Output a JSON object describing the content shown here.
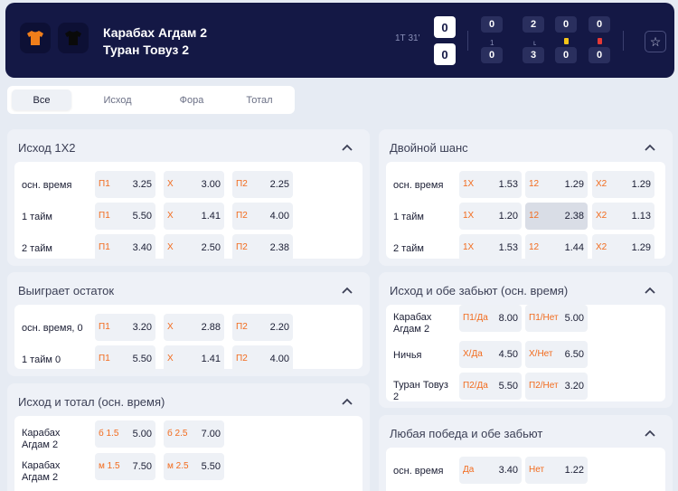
{
  "header": {
    "team1": "Карабах Агдам 2",
    "team2": "Туран Товуз 2",
    "period": "1Т 31'",
    "score1": "0",
    "score2": "0",
    "stats_top": [
      "0",
      "2",
      "0",
      "0"
    ],
    "stats_mid": [
      "1",
      "ʟ"
    ],
    "stats_bottom": [
      "0",
      "3",
      "0",
      "0"
    ],
    "yellow_card_color": "#f5c518",
    "red_card_color": "#e53935",
    "team1_shirt_color": "#f07e1a",
    "team2_shirt_color": "#0a0a0a"
  },
  "tabs": [
    "Все",
    "Исход",
    "Фора",
    "Тотал"
  ],
  "accent_color": "#f26b1d",
  "markets": {
    "m1": {
      "title": "Исход 1X2",
      "rows": [
        {
          "label": "осн. время",
          "odds": [
            {
              "n": "П1",
              "v": "3.25"
            },
            {
              "n": "X",
              "v": "3.00"
            },
            {
              "n": "П2",
              "v": "2.25"
            }
          ]
        },
        {
          "label": "1 тайм",
          "odds": [
            {
              "n": "П1",
              "v": "5.50"
            },
            {
              "n": "X",
              "v": "1.41"
            },
            {
              "n": "П2",
              "v": "4.00"
            }
          ]
        },
        {
          "label": "2 тайм",
          "odds": [
            {
              "n": "П1",
              "v": "3.40"
            },
            {
              "n": "X",
              "v": "2.50"
            },
            {
              "n": "П2",
              "v": "2.38"
            }
          ]
        }
      ]
    },
    "m2": {
      "title": "Выиграет остаток",
      "rows": [
        {
          "label": "осн. время, 0",
          "odds": [
            {
              "n": "П1",
              "v": "3.20"
            },
            {
              "n": "X",
              "v": "2.88"
            },
            {
              "n": "П2",
              "v": "2.20"
            }
          ]
        },
        {
          "label": "1 тайм 0",
          "odds": [
            {
              "n": "П1",
              "v": "5.50"
            },
            {
              "n": "X",
              "v": "1.41"
            },
            {
              "n": "П2",
              "v": "4.00"
            }
          ]
        }
      ]
    },
    "m3": {
      "title": "Исход и тотал (осн. время)",
      "rows": [
        {
          "label": "Карабах Агдам 2",
          "odds": [
            {
              "n": "б 1.5",
              "v": "5.00"
            },
            {
              "n": "б 2.5",
              "v": "7.00"
            }
          ]
        },
        {
          "label": "Карабах Агдам 2",
          "odds": [
            {
              "n": "м 1.5",
              "v": "7.50"
            },
            {
              "n": "м 2.5",
              "v": "5.50"
            }
          ]
        }
      ]
    },
    "m4": {
      "title": "Двойной шанс",
      "rows": [
        {
          "label": "осн. время",
          "odds": [
            {
              "n": "1X",
              "v": "1.53"
            },
            {
              "n": "12",
              "v": "1.29"
            },
            {
              "n": "X2",
              "v": "1.29"
            }
          ]
        },
        {
          "label": "1 тайм",
          "odds": [
            {
              "n": "1X",
              "v": "1.20"
            },
            {
              "n": "12",
              "v": "2.38"
            },
            {
              "n": "X2",
              "v": "1.13"
            }
          ]
        },
        {
          "label": "2 тайм",
          "odds": [
            {
              "n": "1X",
              "v": "1.53"
            },
            {
              "n": "12",
              "v": "1.44"
            },
            {
              "n": "X2",
              "v": "1.29"
            }
          ]
        }
      ]
    },
    "m5": {
      "title": "Исход и обе забьют (осн. время)",
      "rows": [
        {
          "label": "Карабах Агдам 2",
          "odds": [
            {
              "n": "П1/Да",
              "v": "8.00"
            },
            {
              "n": "П1/Нет",
              "v": "5.00"
            }
          ]
        },
        {
          "label": "Ничья",
          "odds": [
            {
              "n": "Х/Да",
              "v": "4.50"
            },
            {
              "n": "Х/Нет",
              "v": "6.50"
            }
          ]
        },
        {
          "label": "Туран Товуз 2",
          "odds": [
            {
              "n": "П2/Да",
              "v": "5.50"
            },
            {
              "n": "П2/Нет",
              "v": "3.20"
            }
          ]
        }
      ]
    },
    "m6": {
      "title": "Любая победа и обе забьют",
      "rows": [
        {
          "label": "осн. время",
          "odds": [
            {
              "n": "Да",
              "v": "3.40"
            },
            {
              "n": "Нет",
              "v": "1.22"
            }
          ]
        }
      ]
    }
  }
}
